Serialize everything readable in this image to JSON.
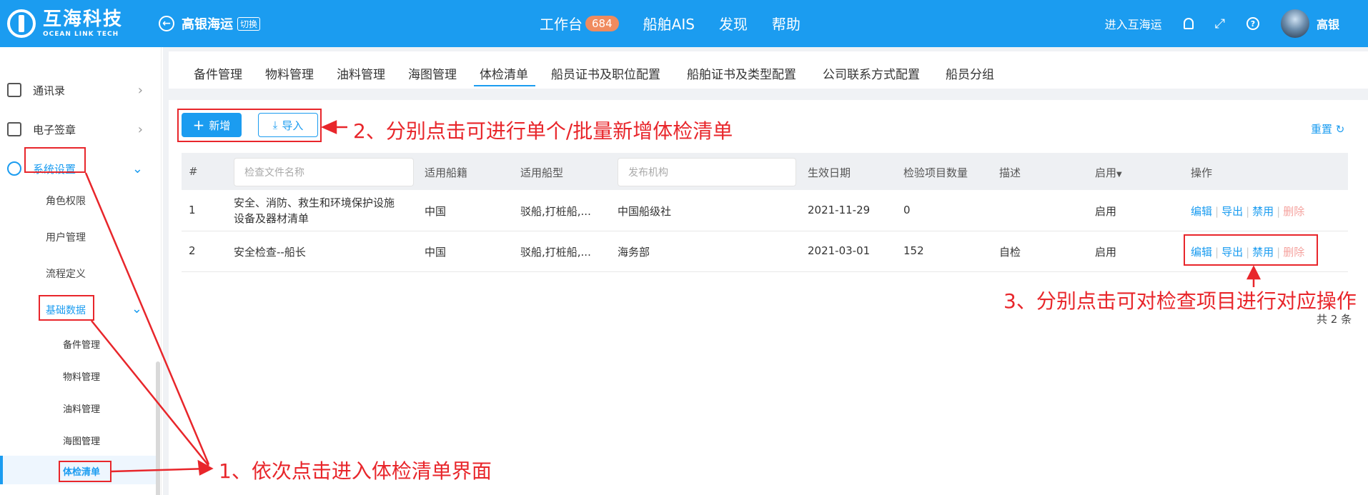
{
  "header": {
    "logo_cn": "互海科技",
    "logo_en": "OCEAN LINK TECH",
    "org_name": "高银海运",
    "switch_label": "切换",
    "nav": [
      {
        "label": "工作台",
        "badge": "684"
      },
      {
        "label": "船舶AIS"
      },
      {
        "label": "发现"
      },
      {
        "label": "帮助"
      }
    ],
    "enter_label": "进入互海运",
    "user_name": "高银"
  },
  "sidebar": {
    "items": [
      {
        "label": "通讯录"
      },
      {
        "label": "电子签章"
      },
      {
        "label": "系统设置"
      }
    ],
    "sub_items": [
      {
        "label": "角色权限"
      },
      {
        "label": "用户管理"
      },
      {
        "label": "流程定义"
      },
      {
        "label": "基础数据"
      }
    ],
    "sub_sub_items": [
      {
        "label": "备件管理"
      },
      {
        "label": "物料管理"
      },
      {
        "label": "油料管理"
      },
      {
        "label": "海图管理"
      },
      {
        "label": "体检清单"
      }
    ]
  },
  "tabs": [
    {
      "label": "备件管理"
    },
    {
      "label": "物料管理"
    },
    {
      "label": "油料管理"
    },
    {
      "label": "海图管理"
    },
    {
      "label": "体检清单"
    },
    {
      "label": "船员证书及职位配置"
    },
    {
      "label": "船舶证书及类型配置"
    },
    {
      "label": "公司联系方式配置"
    },
    {
      "label": "船员分组"
    }
  ],
  "active_tab": "体检清单",
  "toolbar": {
    "new_label": "新增",
    "import_label": "导入",
    "reset_label": "重置"
  },
  "table": {
    "headers": {
      "index": "#",
      "file_name_placeholder": "检查文件名称",
      "flag": "适用船籍",
      "ship_type": "适用船型",
      "org_placeholder": "发布机构",
      "date": "生效日期",
      "count": "检验项目数量",
      "desc": "描述",
      "status": "启用",
      "ops": "操作"
    },
    "rows": [
      {
        "index": "1",
        "name_line1": "安全、消防、救生和环境保护设施",
        "name_line2": "设备及器材清单",
        "flag": "中国",
        "ship_type": "驳船,打桩船,...",
        "org": "中国船级社",
        "date": "2021-11-29",
        "count": "0",
        "desc": "",
        "status": "启用"
      },
      {
        "index": "2",
        "name_line1": "安全检查--船长",
        "name_line2": "",
        "flag": "中国",
        "ship_type": "驳船,打桩船,...",
        "org": "海务部",
        "date": "2021-03-01",
        "count": "152",
        "desc": "自检",
        "status": "启用"
      }
    ],
    "ops": {
      "edit": "编辑",
      "export": "导出",
      "disable": "禁用",
      "delete": "删除"
    },
    "total": "共 2 条"
  },
  "annotations": {
    "step1": "1、依次点击进入体检清单界面",
    "step2": "2、分别点击可进行单个/批量新增体检清单",
    "step3": "3、分别点击可对检查项目进行对应操作"
  },
  "colors": {
    "primary": "#1b9cf0",
    "annotation": "#e8262b",
    "badge": "#f08b5e"
  }
}
